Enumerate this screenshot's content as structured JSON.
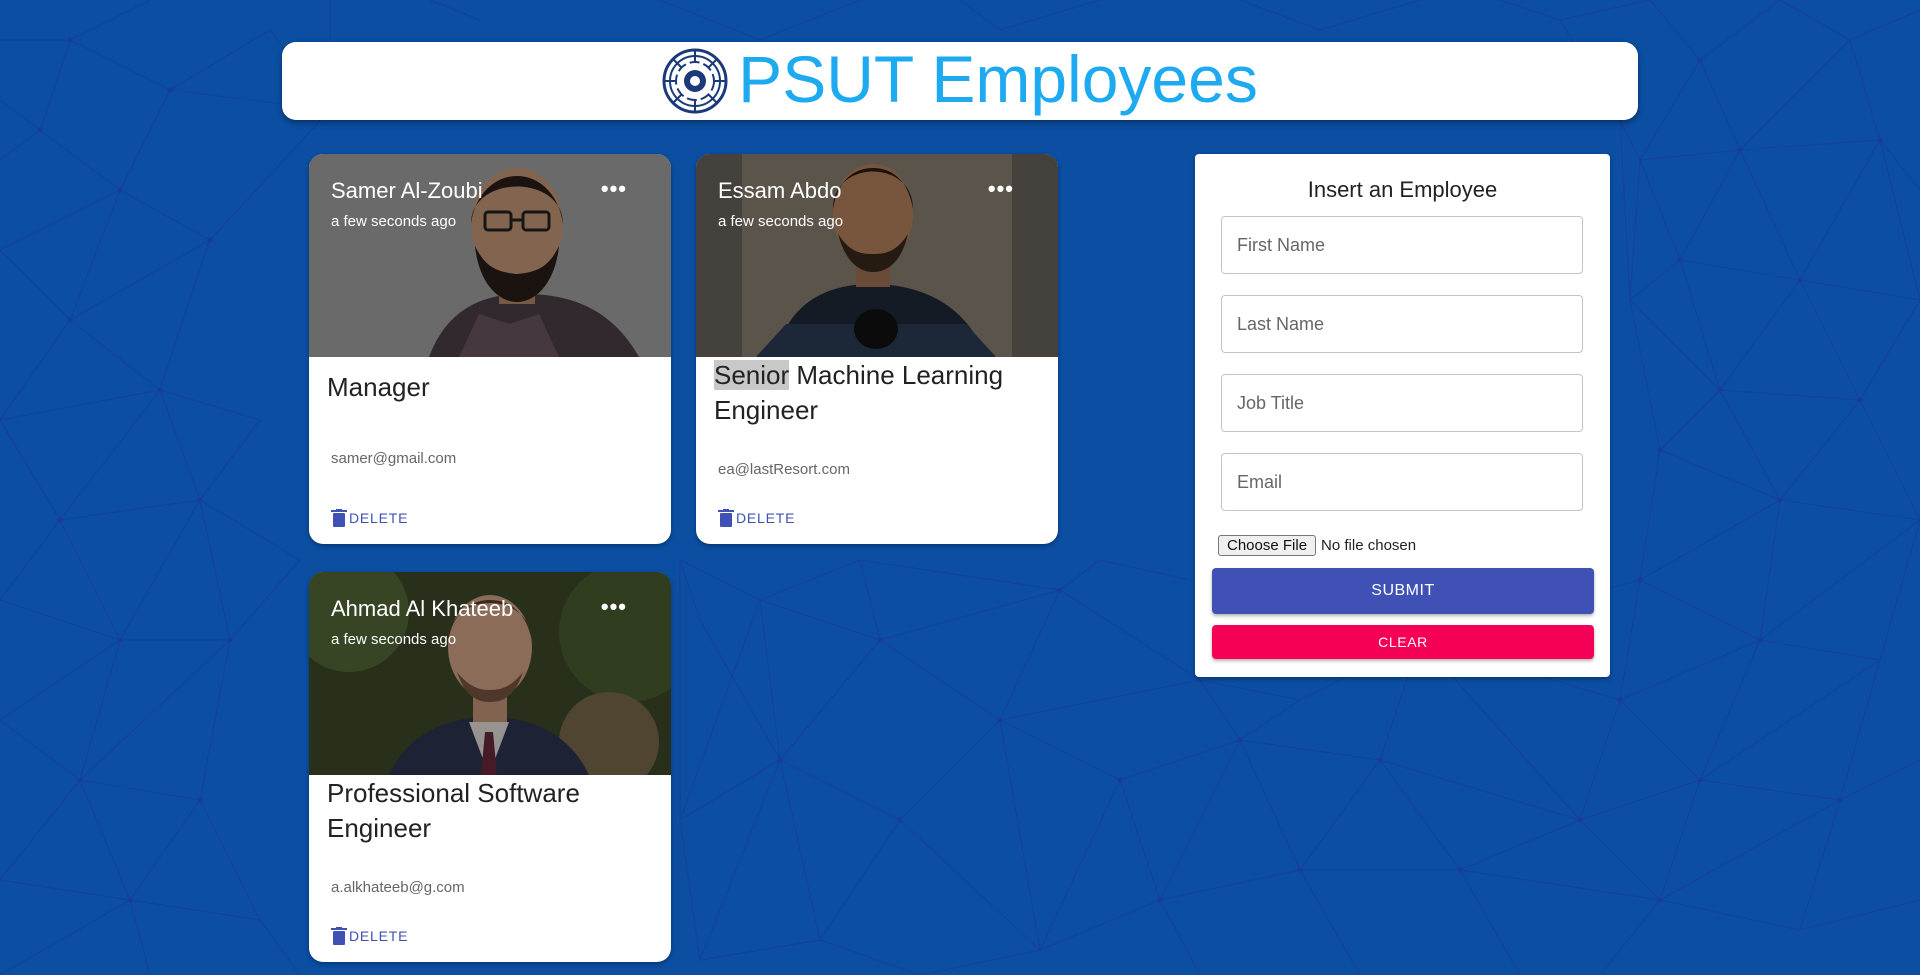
{
  "colors": {
    "background": "#0b4ea2",
    "title": "#1eaaf1",
    "primary": "#3f51b5",
    "secondary": "#f50057"
  },
  "header": {
    "title": "PSUT Employees",
    "logo_icon": "psut-circuit-logo-icon"
  },
  "employees": [
    {
      "name": "Samer Al-Zoubi",
      "time": "a few seconds ago",
      "job_highlight": "",
      "job_rest": "Manager",
      "email": "samer@gmail.com",
      "more_label": "•••",
      "delete_label": "DELETE"
    },
    {
      "name": "Essam Abdo",
      "time": "a few seconds ago",
      "job_highlight": "Senior",
      "job_rest": " Machine Learning Engineer",
      "email": "ea@lastResort.com",
      "more_label": "•••",
      "delete_label": "DELETE"
    },
    {
      "name": "Ahmad Al Khateeb",
      "time": "a few seconds ago",
      "job_highlight": "",
      "job_rest": "Professional Software Engineer",
      "email": "a.alkhateeb@g.com",
      "more_label": "•••",
      "delete_label": "DELETE"
    }
  ],
  "form": {
    "title": "Insert an Employee",
    "first_name_placeholder": "First Name",
    "last_name_placeholder": "Last Name",
    "job_title_placeholder": "Job Title",
    "email_placeholder": "Email",
    "choose_file_label": "Choose File",
    "no_file_text": "No file chosen",
    "submit_label": "SUBMIT",
    "clear_label": "CLEAR"
  }
}
